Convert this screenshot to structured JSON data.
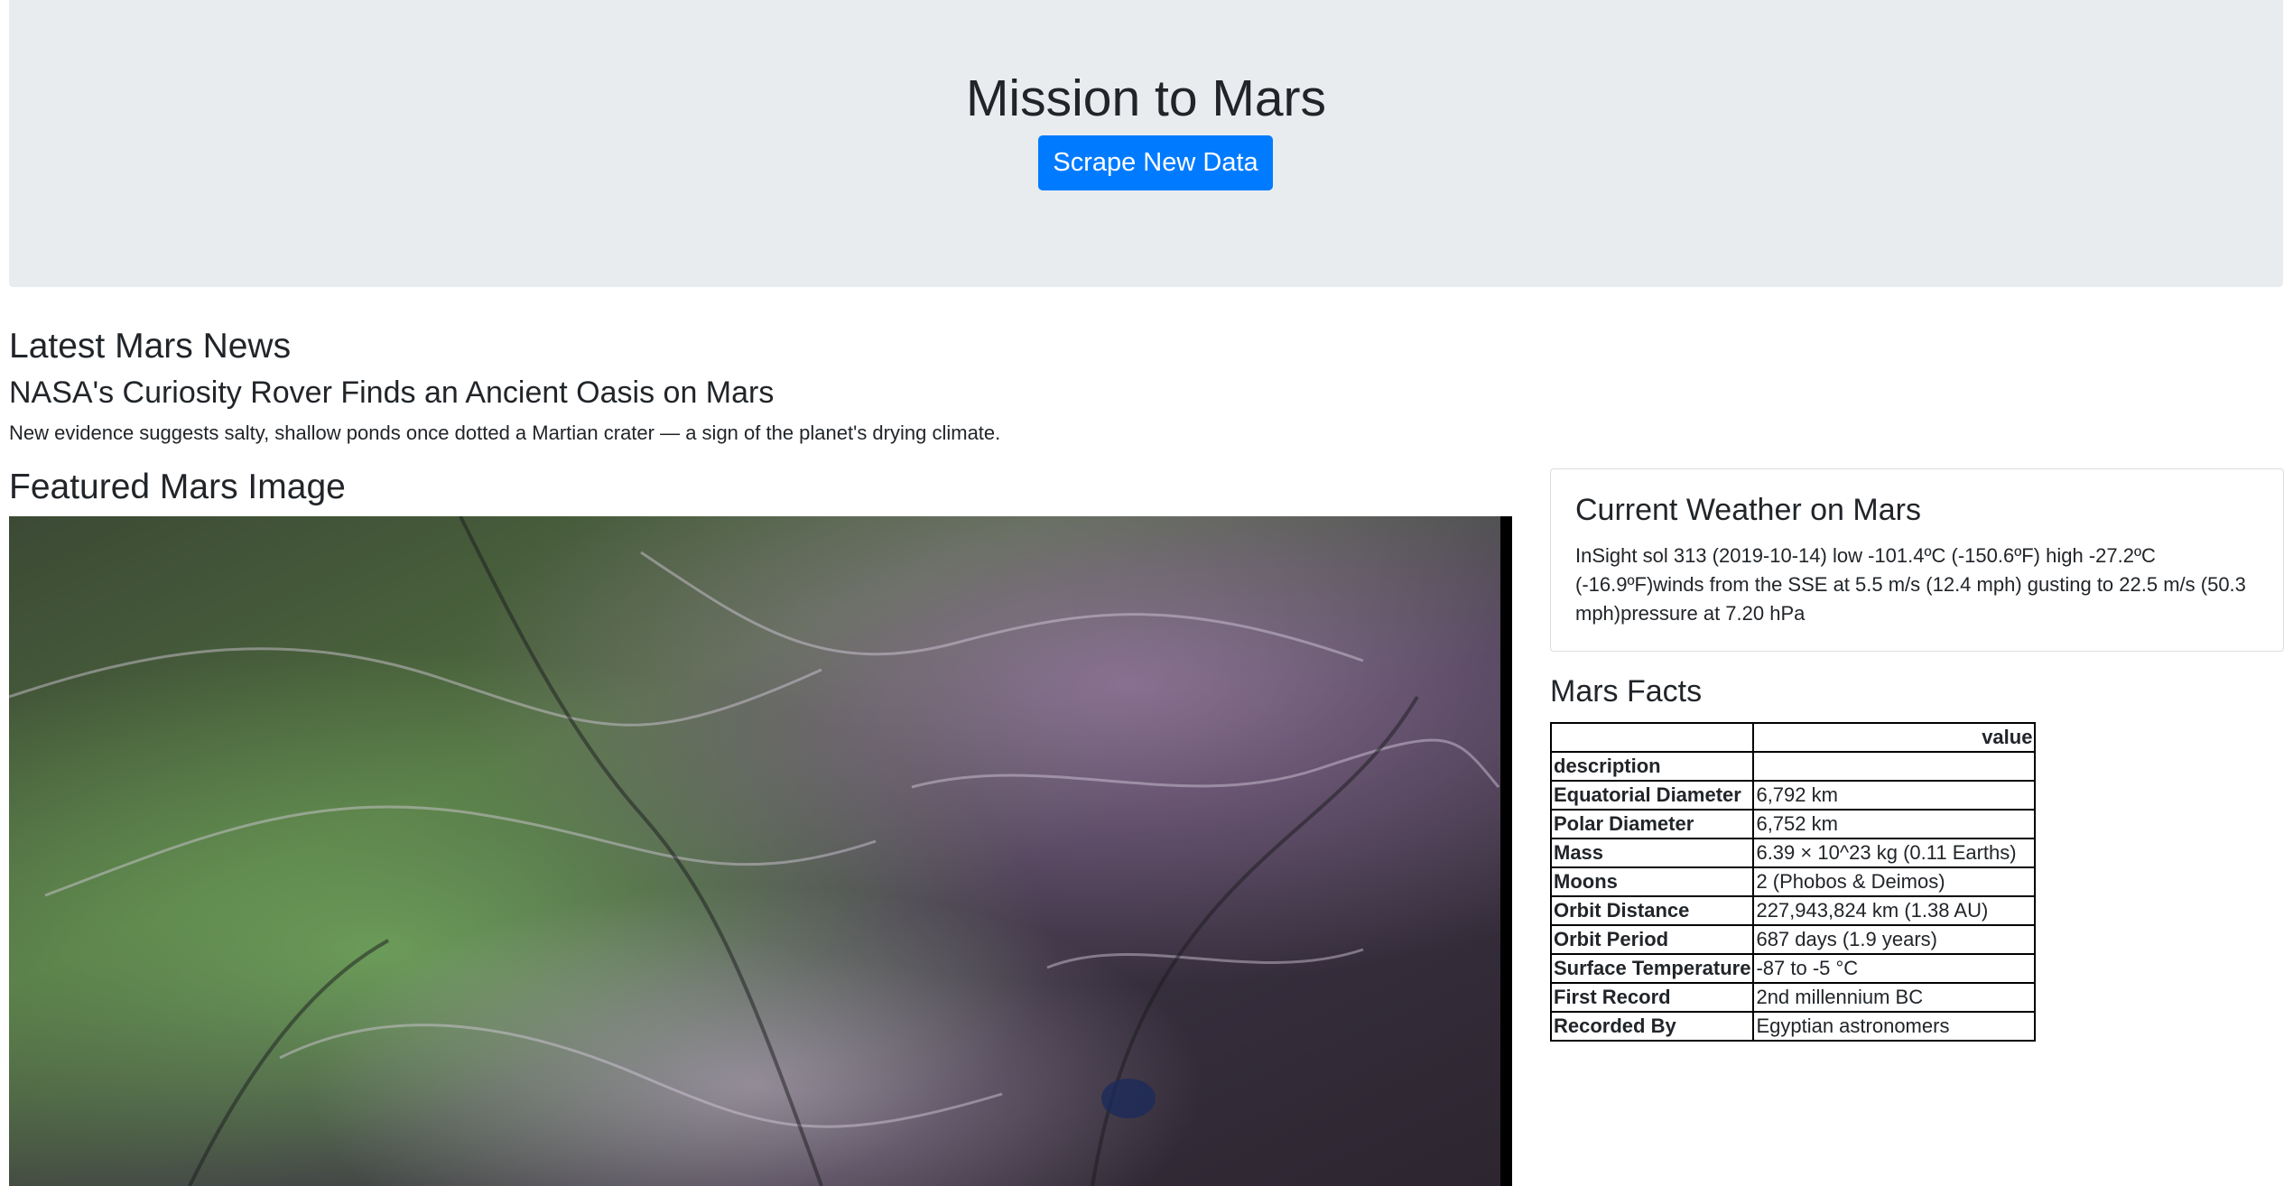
{
  "header": {
    "title": "Mission to Mars",
    "scrape_button": "Scrape New Data"
  },
  "news": {
    "section_title": "Latest Mars News",
    "headline": "NASA's Curiosity Rover Finds an Ancient Oasis on Mars",
    "teaser": "New evidence suggests salty, shallow ponds once dotted a Martian crater — a sign of the planet's drying climate."
  },
  "featured": {
    "section_title": "Featured Mars Image"
  },
  "weather": {
    "title": "Current Weather on Mars",
    "text": "InSight sol 313 (2019-10-14) low -101.4ºC (-150.6ºF) high -27.2ºC (-16.9ºF)winds from the SSE at 5.5 m/s (12.4 mph) gusting to 22.5 m/s (50.3 mph)pressure at 7.20 hPa"
  },
  "facts": {
    "section_title": "Mars Facts",
    "header": [
      "",
      "value"
    ],
    "index_label": "description",
    "rows": [
      [
        "Equatorial Diameter",
        "6,792 km"
      ],
      [
        "Polar Diameter",
        "6,752 km"
      ],
      [
        "Mass",
        "6.39 × 10^23 kg (0.11 Earths)"
      ],
      [
        "Moons",
        "2 (Phobos & Deimos)"
      ],
      [
        "Orbit Distance",
        "227,943,824 km (1.38 AU)"
      ],
      [
        "Orbit Period",
        "687 days (1.9 years)"
      ],
      [
        "Surface Temperature",
        "-87 to -5 °C"
      ],
      [
        "First Record",
        "2nd millennium BC"
      ],
      [
        "Recorded By",
        "Egyptian astronomers"
      ]
    ]
  }
}
